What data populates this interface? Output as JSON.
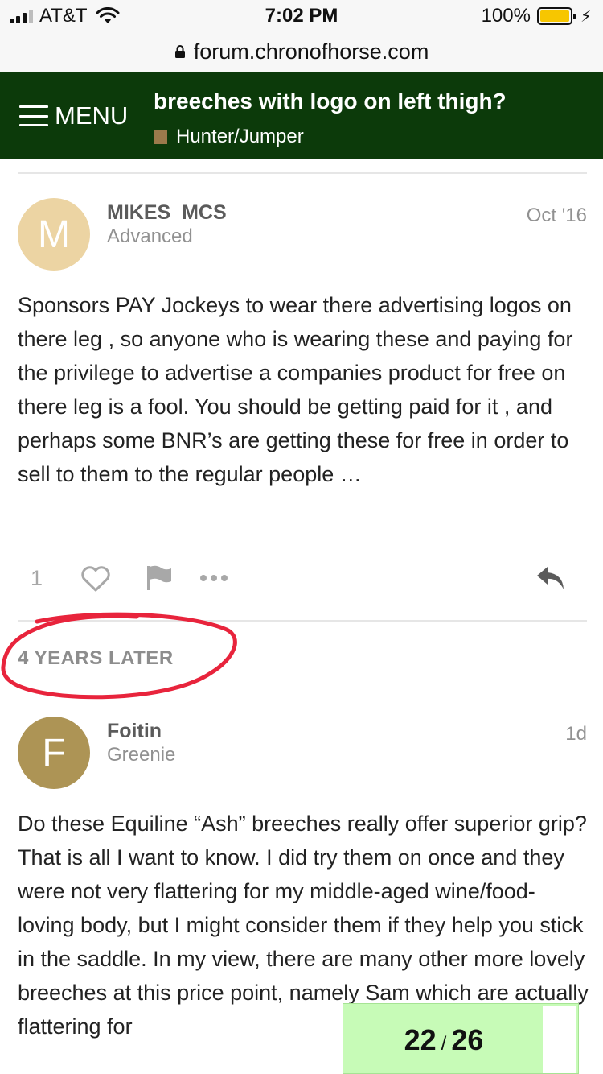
{
  "status_bar": {
    "carrier": "AT&T",
    "time": "7:02 PM",
    "battery_percent": "100%"
  },
  "url_bar": {
    "domain": "forum.chronofhorse.com"
  },
  "header": {
    "menu_label": "MENU",
    "topic_title": "breeches with logo on left thigh?",
    "category": "Hunter/Jumper",
    "category_color": "#9b7a4b",
    "background_color": "#0c3a0a"
  },
  "posts": [
    {
      "avatar_letter": "M",
      "avatar_color": "#ecd4a3",
      "username": "MIKES_MCS",
      "user_title": "Advanced",
      "date": "Oct '16",
      "body": "Sponsors PAY Jockeys to wear there advertising logos on there leg , so anyone who is wearing these and paying for the privilege to advertise a companies product for free on there leg is a fool. You should be getting paid for it , and perhaps some BNR’s are getting these for free in order to sell to them to the regular people …",
      "like_count": "1"
    },
    {
      "avatar_letter": "F",
      "avatar_color": "#ad9455",
      "username": "Foitin",
      "user_title": "Greenie",
      "date": "1d",
      "body": "Do these Equiline “Ash” breeches really offer superior grip? That is all I want to know. I did try them on once and they were not very flattering for my middle-aged wine/food-loving body, but I might consider them if they help you stick in the saddle. In my view, there are many other more lovely breeches at this price point, namely Sam which are actually flattering for"
    }
  ],
  "time_gap": "4 YEARS LATER",
  "progress": {
    "current": "22",
    "separator": "/",
    "total": "26"
  }
}
